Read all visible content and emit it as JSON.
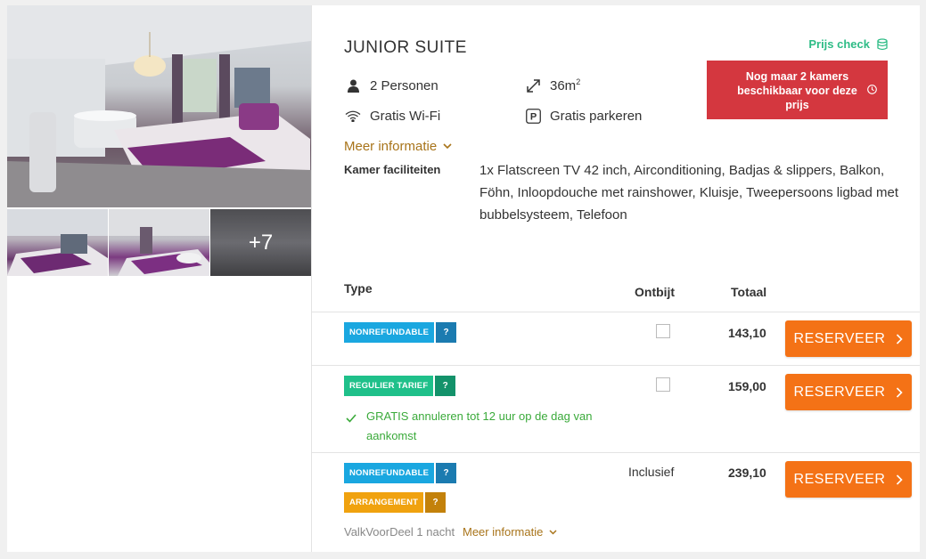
{
  "room": {
    "title": "JUNIOR SUITE",
    "persons": "2 Personen",
    "size": "36m",
    "size_sup": "2",
    "wifi": "Gratis Wi-Fi",
    "parking": "Gratis parkeren",
    "more_info": "Meer informatie",
    "facilities_label": "Kamer faciliteiten",
    "facilities_text": "1x Flatscreen TV 42 inch, Airconditioning, Badjas & slippers, Balkon, Föhn, Inloopdouche met rainshower, Kluisje, Tweepersoons ligbad met bubbelsysteem, Telefoon"
  },
  "gallery": {
    "more_count": "+7"
  },
  "prijs_check": "Prijs check",
  "alert": "Nog maar 2 kamers beschikbaar voor deze prijs",
  "table": {
    "col_type": "Type",
    "col_breakfast": "Ontbijt",
    "col_total": "Totaal"
  },
  "rates": [
    {
      "tag": "NONREFUNDABLE",
      "q": "?",
      "price": "143,10",
      "button": "RESERVEER"
    },
    {
      "tag": "REGULIER TARIEF",
      "q": "?",
      "price": "159,00",
      "button": "RESERVEER",
      "note": "GRATIS annuleren tot 12 uur op de dag van aankomst"
    },
    {
      "tag": "NONREFUNDABLE",
      "q": "?",
      "tag2": "ARRANGEMENT",
      "q2": "?",
      "breakfast": "Inclusief",
      "price": "239,10",
      "button": "RESERVEER",
      "package": "ValkVoorDeel 1 nacht",
      "more_info": "Meer informatie"
    }
  ],
  "colors": {
    "nonrefundable": "#1aa7e0",
    "nonrefundable_q": "#1b7bb0",
    "regulier": "#1fc08a",
    "regulier_q": "#13926a",
    "arrangement": "#f0a20f",
    "arrangement_q": "#c3810a",
    "reserve": "#f47216",
    "alert": "#d4373f"
  }
}
